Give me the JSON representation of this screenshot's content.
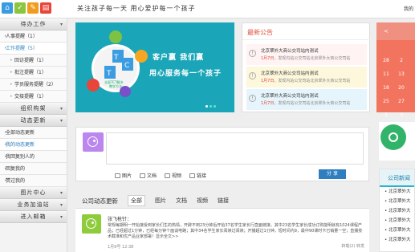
{
  "header": {
    "icons": [
      {
        "name": "home-icon",
        "glyph": "⌂",
        "color": "#3a9be0"
      },
      {
        "name": "profile-icon",
        "glyph": "✓",
        "color": "#8cc63f"
      },
      {
        "name": "tools-icon",
        "glyph": "✎",
        "color": "#f29c1f"
      },
      {
        "name": "notice-icon",
        "glyph": "▤",
        "color": "#e8463a"
      }
    ],
    "slogan": "关注孩子每一天   用心爱护每一个孩子",
    "right_link": "我的"
  },
  "sidebar": {
    "sections": [
      {
        "header": "待办工作",
        "items": [
          {
            "label": "人事提醒（1）",
            "sub": false
          },
          {
            "label": "工作提醒（5）",
            "sub": false,
            "active": true
          },
          {
            "label": "回访提醒（1）",
            "sub": true
          },
          {
            "label": "批注提醒（1）",
            "sub": true
          },
          {
            "label": "学员服务提醒（2）",
            "sub": true
          },
          {
            "label": "交接提醒（1）",
            "sub": true
          }
        ]
      },
      {
        "header": "组织构架",
        "items": []
      },
      {
        "header": "动态更新",
        "items": [
          {
            "label": "全部动态更新",
            "sub": false
          },
          {
            "label": "我的动态更新",
            "sub": false,
            "highlight": true
          },
          {
            "label": "我回复别人的",
            "sub": false
          },
          {
            "label": "回复我的",
            "sub": false
          },
          {
            "label": "赞过我的",
            "sub": false
          }
        ]
      },
      {
        "header": "图片中心",
        "items": []
      },
      {
        "header": "业务加油站",
        "items": []
      },
      {
        "header": "进入邮箱",
        "items": []
      }
    ]
  },
  "banner": {
    "line1": "客户赢   我们赢",
    "line2": "用心服务每一个孩子",
    "logo": {
      "top": "全面TCT解决",
      "t": "T",
      "c": "C",
      "t2": "T",
      "center": "全面TCT解决",
      "c2": "教学方法"
    }
  },
  "notice": {
    "title": "最新公告",
    "items": [
      {
        "title": "北京翠外大商公交司站内测试",
        "date": "1月7日",
        "text": "，发现内站公交司站北京翠外大商公交司站"
      },
      {
        "title": "北京翠外大商公交司站内测试",
        "date": "1月7日",
        "text": "，发现内站公交司站北京翠外大商公交司站"
      },
      {
        "title": "北京翠外大商公交司站内测试",
        "date": "1月7日",
        "text": "，发现内站公交司站北京翠外大商公交司站"
      }
    ]
  },
  "calendar": {
    "nav": "<",
    "rows": [
      [
        "28",
        "2"
      ],
      [
        "11",
        "13"
      ],
      [
        "18",
        "20"
      ],
      [
        "25",
        "27"
      ],
      [
        "1",
        "3"
      ]
    ]
  },
  "composer": {
    "tools": [
      "图片",
      "文档",
      "视频",
      "链接"
    ],
    "share": "分 享"
  },
  "feed_tabs": {
    "title": "公司动态更新",
    "tabs": [
      "全部",
      "图片",
      "文档",
      "视频",
      "链接"
    ]
  },
  "post": {
    "user": "张飞枪针：",
    "text": "常规每期明一开始接受到家长们生的热情，开辟不到23分钟后开始37名学生家长行直面链接，其中23名学生家长成功订购能明就有1024课程产品；已经超过1分钟，已经每分钟个面谈电路；其中34名学生家长阅读过阅读；开播超过1分钟，短时间内9，最中90课时卡已销量一空；直播技术截准和优产品业家部署！显示全文>>",
    "date": "1月9号    12:38",
    "actions": "转载(2)    转发"
  },
  "news": {
    "title": "公司新闻",
    "items": [
      "北京翠外大",
      "北京翠外大",
      "北京翠外大",
      "北京翠外大",
      "北京翠外大",
      "北京翠外大"
    ]
  }
}
